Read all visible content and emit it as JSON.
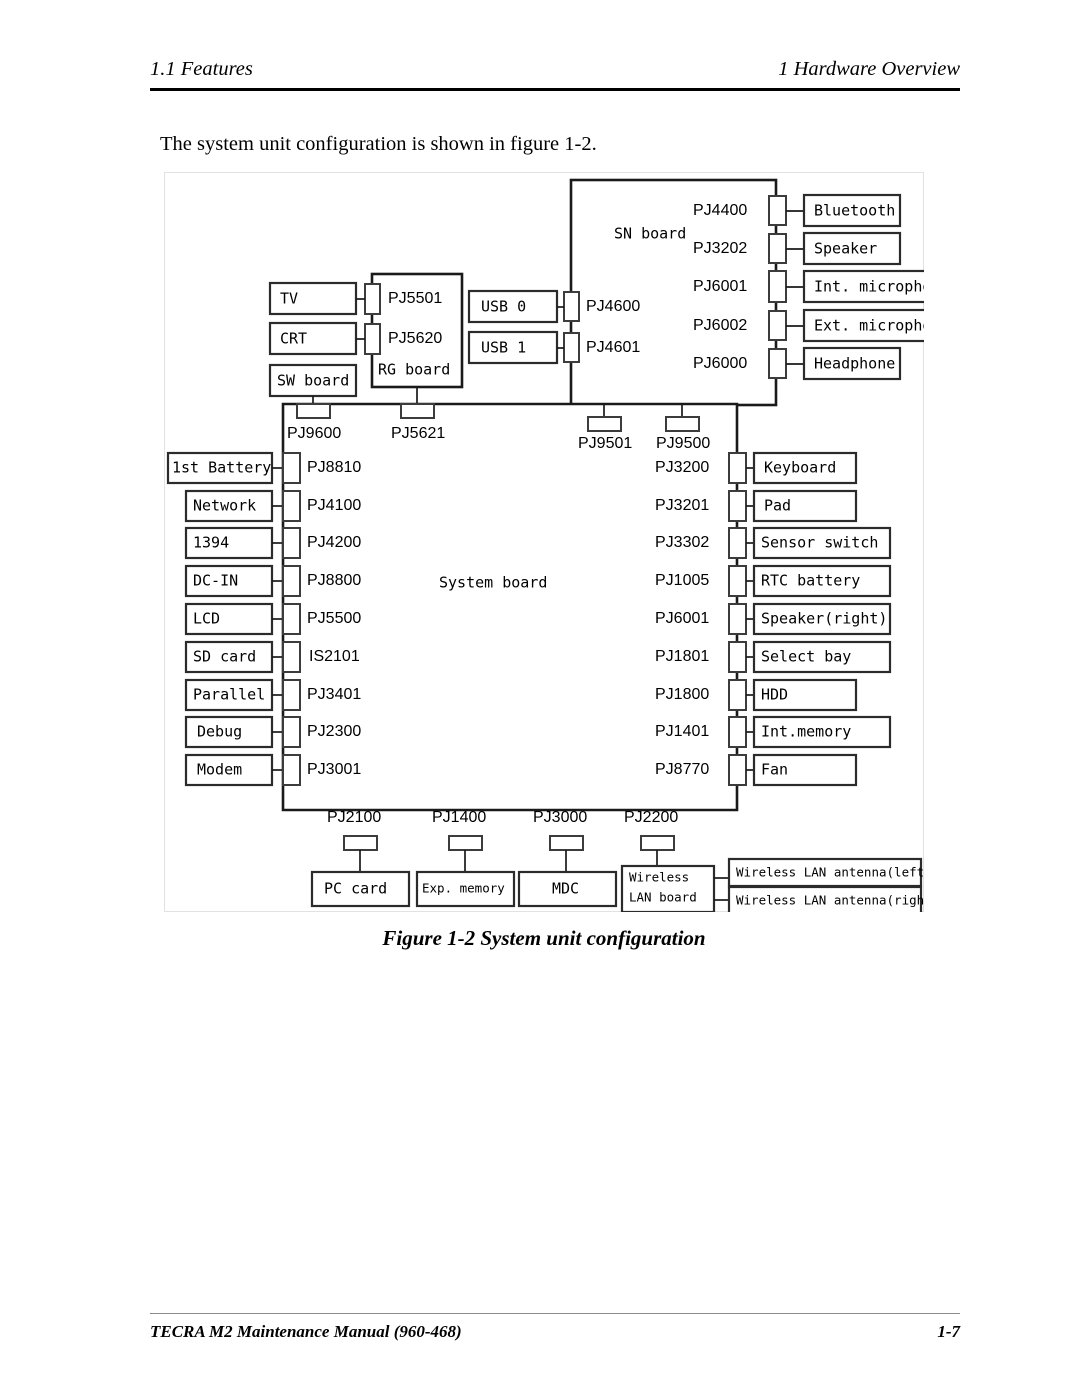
{
  "header": {
    "left": "1.1 Features",
    "right": "1  Hardware Overview"
  },
  "intro": {
    "text": "The system unit configuration is shown in figure 1-2."
  },
  "figure": {
    "caption": "Figure 1-2  System unit configuration"
  },
  "footer": {
    "left": "TECRA M2 Maintenance Manual (960-468)",
    "right": "1-7"
  },
  "diagram": {
    "boards": {
      "sn_board": "SN board",
      "rg_board": "RG board",
      "sw_board": "SW board",
      "system_board": "System board",
      "wireless_lan_board_line1": "Wireless",
      "wireless_lan_board_line2": "LAN board"
    },
    "rg_inputs": [
      {
        "device": "TV",
        "connector": "PJ5501"
      },
      {
        "device": "CRT",
        "connector": "PJ5620"
      }
    ],
    "usb_inputs": [
      {
        "device": "USB 0",
        "connector": "PJ4600"
      },
      {
        "device": "USB 1",
        "connector": "PJ4601"
      }
    ],
    "sn_outputs": [
      {
        "connector": "PJ4400",
        "device": "Bluetooth"
      },
      {
        "connector": "PJ3202",
        "device": "Speaker"
      },
      {
        "connector": "PJ6001",
        "device": "Int. microphone"
      },
      {
        "connector": "PJ6002",
        "device": "Ext. microphone"
      },
      {
        "connector": "PJ6000",
        "device": "Headphone"
      }
    ],
    "system_top_connectors": [
      "PJ9600",
      "PJ5621",
      "PJ9501",
      "PJ9500"
    ],
    "left_devices": [
      {
        "device": "1st Battery",
        "connector": "PJ8810"
      },
      {
        "device": "Network",
        "connector": "PJ4100"
      },
      {
        "device": "1394",
        "connector": "PJ4200"
      },
      {
        "device": "DC-IN",
        "connector": "PJ8800"
      },
      {
        "device": "LCD",
        "connector": "PJ5500"
      },
      {
        "device": "SD card",
        "connector": "IS2101"
      },
      {
        "device": "Parallel",
        "connector": "PJ3401"
      },
      {
        "device": "Debug",
        "connector": "PJ2300"
      },
      {
        "device": "Modem",
        "connector": "PJ3001"
      }
    ],
    "right_devices": [
      {
        "connector": "PJ3200",
        "device": "Keyboard"
      },
      {
        "connector": "PJ3201",
        "device": "Pad"
      },
      {
        "connector": "PJ3302",
        "device": "Sensor switch"
      },
      {
        "connector": "PJ1005",
        "device": "RTC battery"
      },
      {
        "connector": "PJ6001",
        "device": "Speaker(right)"
      },
      {
        "connector": "PJ1801",
        "device": "Select bay"
      },
      {
        "connector": "PJ1800",
        "device": "HDD"
      },
      {
        "connector": "PJ1401",
        "device": "Int.memory"
      },
      {
        "connector": "PJ8770",
        "device": "Fan"
      }
    ],
    "bottom_devices": [
      {
        "connector": "PJ2100",
        "device": "PC card"
      },
      {
        "connector": "PJ1400",
        "device": "Exp. memory"
      },
      {
        "connector": "PJ3000",
        "device": "MDC"
      },
      {
        "connector": "PJ2200",
        "device": ""
      }
    ],
    "antennas": [
      "Wireless LAN antenna(left)",
      "Wireless LAN antenna(right)"
    ]
  }
}
